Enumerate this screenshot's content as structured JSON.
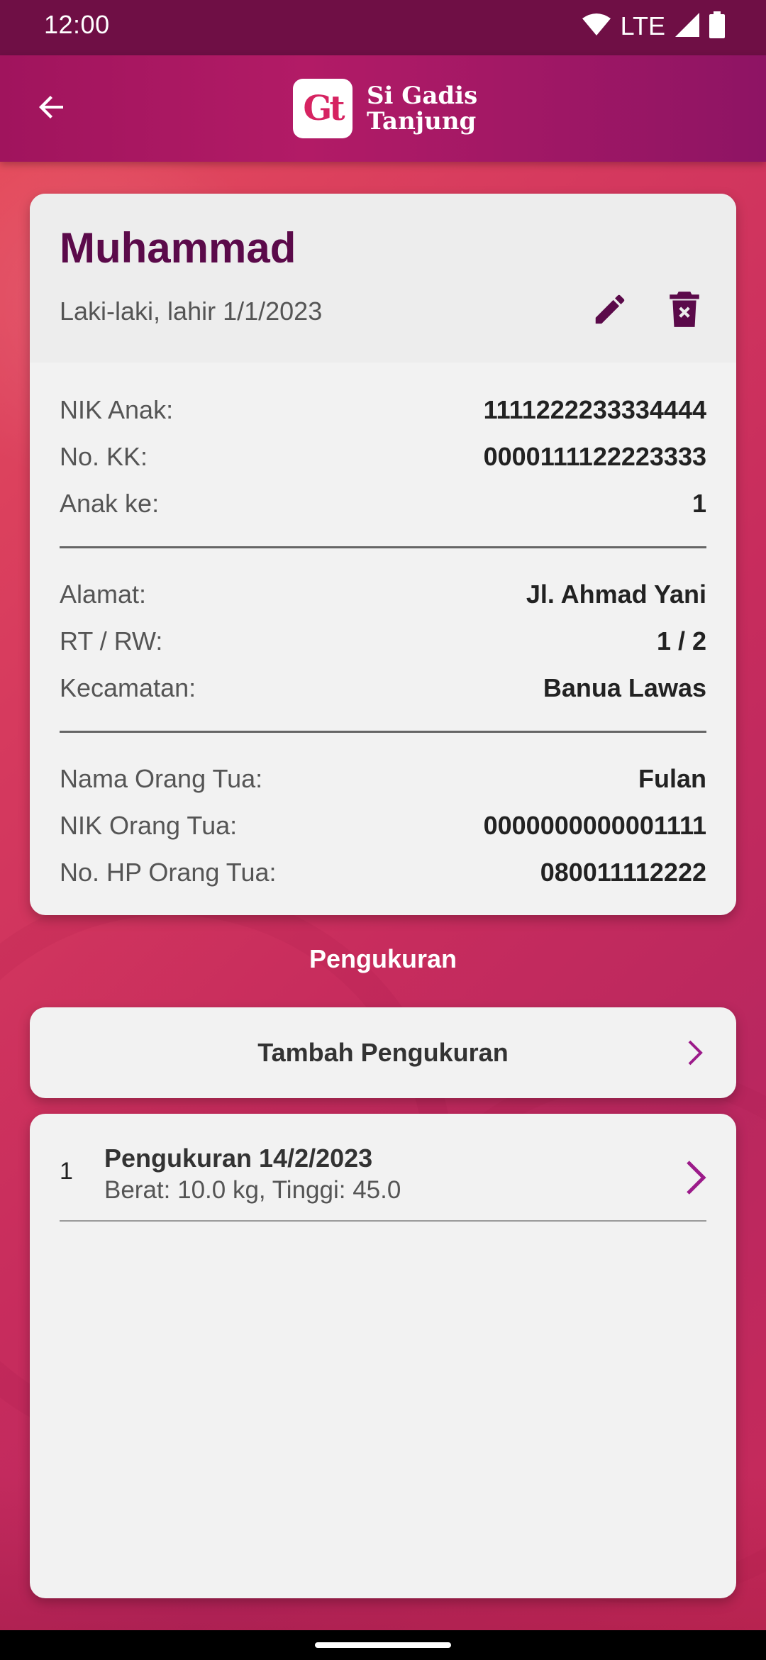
{
  "status_bar": {
    "time": "12:00",
    "network": "LTE",
    "icons": [
      "wifi-icon",
      "signal-icon",
      "battery-icon"
    ]
  },
  "app_bar": {
    "back_icon": "arrow-back-icon",
    "logo_mark": "Gt",
    "logo_line1": "Si Gadis",
    "logo_line2": "Tanjung"
  },
  "child": {
    "name": "Muhammad",
    "subtitle": "Laki-laki, lahir 1/1/2023",
    "edit_icon": "pencil-icon",
    "delete_icon": "trash-icon"
  },
  "details": {
    "identity": [
      {
        "label": "NIK Anak:",
        "value": "1111222233334444"
      },
      {
        "label": "No. KK:",
        "value": "0000111122223333"
      },
      {
        "label": "Anak ke:",
        "value": "1"
      }
    ],
    "address": [
      {
        "label": "Alamat:",
        "value": "Jl. Ahmad Yani"
      },
      {
        "label": "RT / RW:",
        "value": "1 / 2"
      },
      {
        "label": "Kecamatan:",
        "value": "Banua Lawas"
      }
    ],
    "parent": [
      {
        "label": "Nama Orang Tua:",
        "value": "Fulan"
      },
      {
        "label": "NIK Orang Tua:",
        "value": "0000000000001111"
      },
      {
        "label": "No. HP Orang Tua:",
        "value": "080011112222"
      }
    ]
  },
  "measurements": {
    "section_title": "Pengukuran",
    "add_label": "Tambah Pengukuran",
    "items": [
      {
        "index": "1",
        "title": "Pengukuran 14/2/2023",
        "subtitle": "Berat: 10.0 kg, Tinggi: 45.0"
      }
    ]
  },
  "colors": {
    "accent": "#9c1b8a",
    "name_color": "#5b0a4a",
    "status_bar": "#6f0f45",
    "app_bar": "#a0145d"
  }
}
